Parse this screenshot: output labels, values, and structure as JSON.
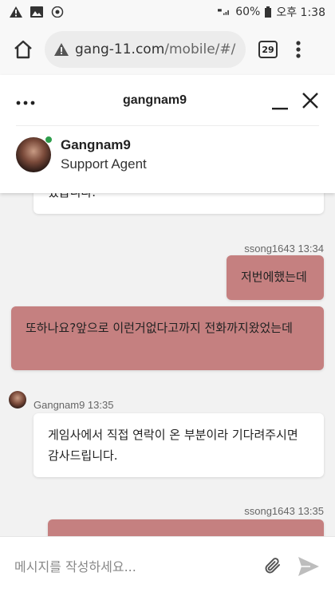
{
  "status_bar": {
    "battery": "60%",
    "time": "오후 1:38"
  },
  "browser": {
    "url_host": "gang-11.com",
    "url_path": "/mobile/#/",
    "tab_count": "29"
  },
  "chat": {
    "title": "gangnam9",
    "agent": {
      "name": "Gangnam9",
      "role": "Support Agent"
    },
    "messages": [
      {
        "sender": "agent",
        "text": "었습니다."
      },
      {
        "sender": "user",
        "meta": "ssong1643 13:34",
        "text": "저번에했는데"
      },
      {
        "sender": "user",
        "text": "또하나요?앞으로 이런거없다고까지 전화까지왔었는데"
      },
      {
        "sender": "agent",
        "meta": "Gangnam9 13:35",
        "text": "게임사에서 직접 연락이 온 부분이라 기다려주시면 감사드립니다."
      },
      {
        "sender": "user",
        "meta": "ssong1643 13:35",
        "text": ""
      }
    ]
  },
  "input": {
    "placeholder": "메시지를 작성하세요..."
  },
  "colors": {
    "user_bubble": "#c58080",
    "agent_bubble": "#ffffff",
    "online": "#2e9e4c"
  }
}
